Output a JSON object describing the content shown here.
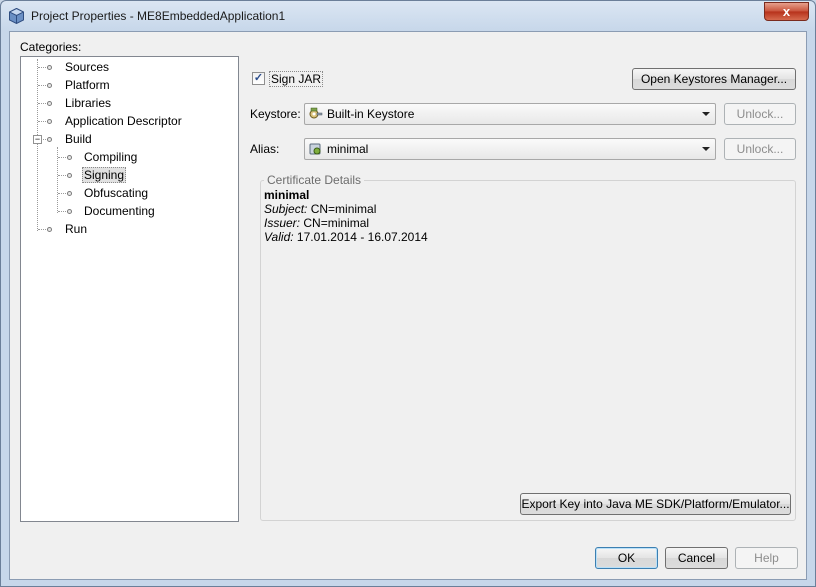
{
  "window": {
    "title": "Project Properties - ME8EmbeddedApplication1",
    "close_glyph": "x"
  },
  "categories": {
    "label": "Categories:",
    "items": [
      {
        "label": "Sources"
      },
      {
        "label": "Platform"
      },
      {
        "label": "Libraries"
      },
      {
        "label": "Application Descriptor"
      },
      {
        "label": "Build",
        "expanded": true,
        "children": [
          {
            "label": "Compiling"
          },
          {
            "label": "Signing",
            "selected": true
          },
          {
            "label": "Obfuscating"
          },
          {
            "label": "Documenting"
          }
        ]
      },
      {
        "label": "Run"
      }
    ]
  },
  "signing": {
    "sign_jar_label": "Sign JAR",
    "sign_jar_checked": true,
    "open_keystores_label": "Open Keystores Manager...",
    "keystore_label": "Keystore:",
    "keystore_value": "Built-in Keystore",
    "keystore_unlock_label": "Unlock...",
    "alias_label": "Alias:",
    "alias_value": "minimal",
    "alias_unlock_label": "Unlock...",
    "certificate": {
      "legend": "Certificate Details",
      "name": "minimal",
      "subject_label": "Subject:",
      "subject_value": "CN=minimal",
      "issuer_label": "Issuer:",
      "issuer_value": "CN=minimal",
      "valid_label": "Valid:",
      "valid_value": "17.01.2014 - 16.07.2014"
    },
    "export_label": "Export Key into Java ME SDK/Platform/Emulator..."
  },
  "footer": {
    "ok_label": "OK",
    "cancel_label": "Cancel",
    "help_label": "Help"
  }
}
